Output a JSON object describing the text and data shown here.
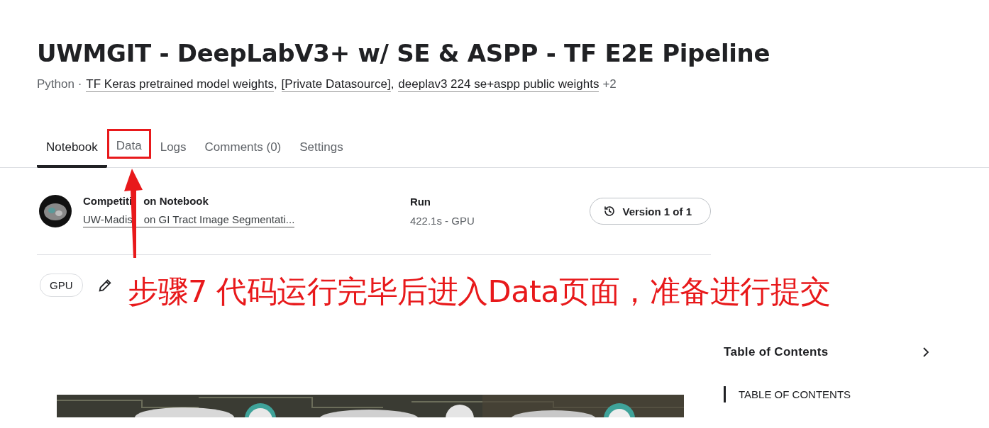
{
  "title": "UWMGIT - DeepLabV3+ w/ SE & ASPP - TF E2E Pipeline",
  "subtitle": {
    "language": "Python",
    "separator": "·",
    "list_separator": ",",
    "sources": [
      "TF Keras pretrained model weights",
      "[Private Datasource]",
      "deeplav3 224 se+aspp public weights"
    ],
    "more": "+2"
  },
  "tabs": [
    {
      "label": "Notebook",
      "selected": true,
      "highlighted": false
    },
    {
      "label": "Data",
      "selected": false,
      "highlighted": true
    },
    {
      "label": "Logs",
      "selected": false,
      "highlighted": false
    },
    {
      "label": "Comments (0)",
      "selected": false,
      "highlighted": false
    },
    {
      "label": "Settings",
      "selected": false,
      "highlighted": false
    }
  ],
  "source": {
    "heading": [
      "Competiti",
      "on Notebook"
    ],
    "link": [
      "UW-Madis",
      "on GI Tract Image Segmentati..."
    ]
  },
  "run": {
    "heading": "Run",
    "value": "422.1s - GPU"
  },
  "version_button": "Version 1 of 1",
  "accelerator": "GPU",
  "annotation": "步骤7  代码运行完毕后进入Data页面，准备进行提交",
  "toc": {
    "title": "Table of Contents",
    "items": [
      {
        "label": "TABLE OF CONTENTS",
        "selected": true
      }
    ]
  }
}
